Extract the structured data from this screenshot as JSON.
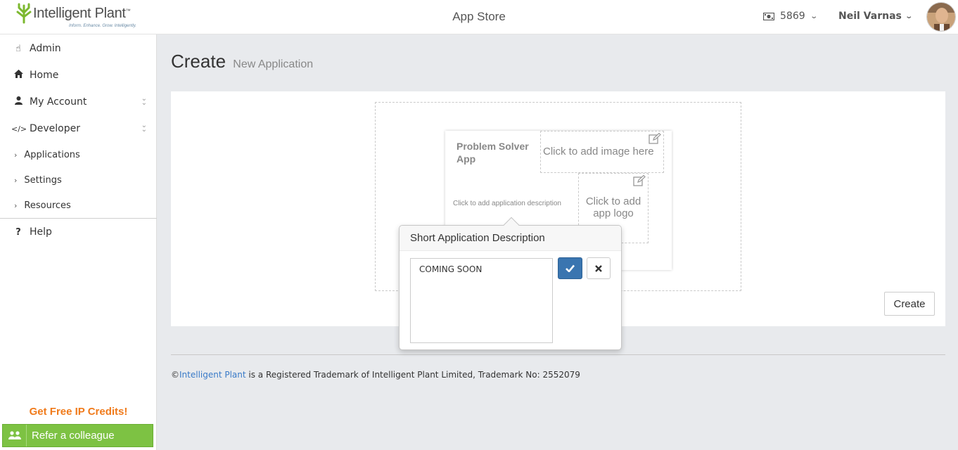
{
  "header": {
    "brand_name": "Intelligent Plant",
    "brand_trademark": "™",
    "brand_tagline": "Inform. Enhance. Grow. Intelligently.",
    "app_title": "App Store",
    "credits_value": "5869",
    "user_name": "Neil Varnas"
  },
  "sidebar": {
    "items": [
      {
        "label": "Admin",
        "icon": "hand-pointer-icon"
      },
      {
        "label": "Home",
        "icon": "home-icon"
      },
      {
        "label": "My Account",
        "icon": "user-icon"
      },
      {
        "label": "Developer",
        "icon": "code-icon"
      }
    ],
    "sub_items": [
      {
        "label": "Applications"
      },
      {
        "label": "Settings"
      },
      {
        "label": "Resources"
      }
    ],
    "help_label": "Help",
    "free_credits_label": "Get Free IP Credits!",
    "refer_label": "Refer a colleague"
  },
  "page": {
    "title": "Create",
    "subtitle": "New Application"
  },
  "card": {
    "title": "Problem Solver App",
    "description_placeholder": "Click to add application description",
    "image_placeholder": "Click to add image here",
    "logo_placeholder": "Click to add app logo"
  },
  "create_button_label": "Create",
  "popover": {
    "title": "Short Application Description",
    "text_value": "COMING SOON"
  },
  "footer": {
    "copyright_symbol": "©",
    "link_text": "Intelligent Plant",
    "text": " is a Registered Trademark of Intelligent Plant Limited, Trademark No: 2552079"
  },
  "colors": {
    "accent_blue": "#3a75b0",
    "credits_orange": "#f07a1a",
    "refer_green": "#7dc243",
    "logo_green": "#7cb82f"
  }
}
